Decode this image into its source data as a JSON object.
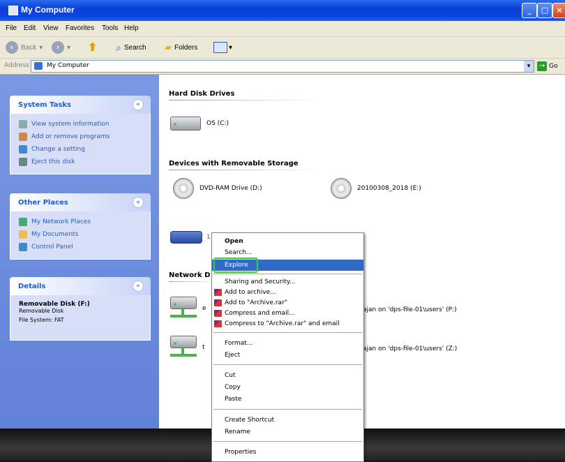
{
  "window": {
    "title": "My Computer"
  },
  "menubar": {
    "items": [
      "File",
      "Edit",
      "View",
      "Favorites",
      "Tools",
      "Help"
    ]
  },
  "toolbar": {
    "back": "Back",
    "search": "Search",
    "folders": "Folders"
  },
  "address": {
    "label": "Address",
    "value": "My Computer",
    "go": "Go"
  },
  "left_pane": {
    "system_tasks": {
      "title": "System Tasks",
      "items": [
        "View system information",
        "Add or remove programs",
        "Change a setting",
        "Eject this disk"
      ]
    },
    "other_places": {
      "title": "Other Places",
      "items": [
        "My Network Places",
        "My Documents",
        "Control Panel"
      ]
    },
    "details": {
      "title": "Details",
      "name": "Removable Disk (F:)",
      "type": "Removable Disk",
      "fs": "File System: FAT"
    }
  },
  "main": {
    "sections": {
      "hdd": "Hard Disk Drives",
      "removable": "Devices with Removable Storage",
      "network": "Network D"
    },
    "hdd_drives": [
      {
        "label": "OS (C:)"
      }
    ],
    "removable_drives": [
      {
        "label": "DVD-RAM Drive (D:)"
      },
      {
        "label": "20100308_2018 (E:)"
      },
      {
        "label": "1"
      }
    ],
    "network_drives": [
      {
        "prefix": "e",
        "label": "ajan on 'dps-file-01\\users' (P:)"
      },
      {
        "prefix": "t",
        "label": "ajan on 'dps-file-01\\users' (Z:)"
      }
    ]
  },
  "context_menu": {
    "items": [
      {
        "label": "Open"
      },
      {
        "label": "Search..."
      },
      {
        "label": "Explore"
      },
      {
        "label": "Sharing and Security..."
      },
      {
        "label": "Add to archive..."
      },
      {
        "label": "Add to \"Archive.rar\""
      },
      {
        "label": "Compress and email..."
      },
      {
        "label": "Compress to \"Archive.rar\" and email"
      },
      {
        "label": "Format..."
      },
      {
        "label": "Eject"
      },
      {
        "label": "Cut"
      },
      {
        "label": "Copy"
      },
      {
        "label": "Paste"
      },
      {
        "label": "Create Shortcut"
      },
      {
        "label": "Rename"
      },
      {
        "label": "Properties"
      }
    ]
  },
  "colors": {
    "title_bar": "#0a3fd6",
    "task_pane": "#6f8fdc",
    "highlight": "#316ac5",
    "focus_outline": "#35d335"
  }
}
